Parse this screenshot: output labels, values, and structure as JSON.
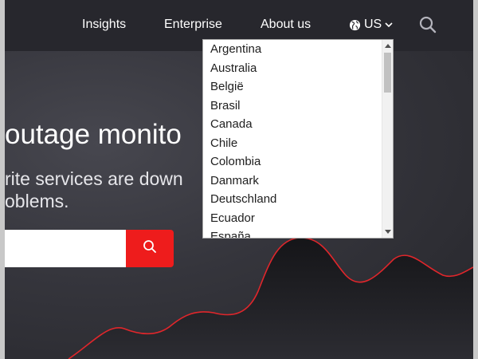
{
  "nav": {
    "links": [
      "Insights",
      "Enterprise",
      "About us"
    ],
    "region_label": "US"
  },
  "hero": {
    "title": "outage monito",
    "subtitle_line1": "rite services are down",
    "subtitle_line2": "oblems.",
    "search_value": ""
  },
  "region_dropdown": {
    "options": [
      "Argentina",
      "Australia",
      "België",
      "Brasil",
      "Canada",
      "Chile",
      "Colombia",
      "Danmark",
      "Deutschland",
      "Ecuador",
      "España"
    ],
    "scroll_position": 0.0
  },
  "icons": {
    "region": "globe-icon",
    "region_caret": "chevron-down-icon",
    "nav_search": "search-icon",
    "search_submit": "search-icon"
  },
  "colors": {
    "accent": "#ee1c1c",
    "nav_bg": "#27272d",
    "hero_bg": "#35353c",
    "wave_line": "#e0262b"
  }
}
